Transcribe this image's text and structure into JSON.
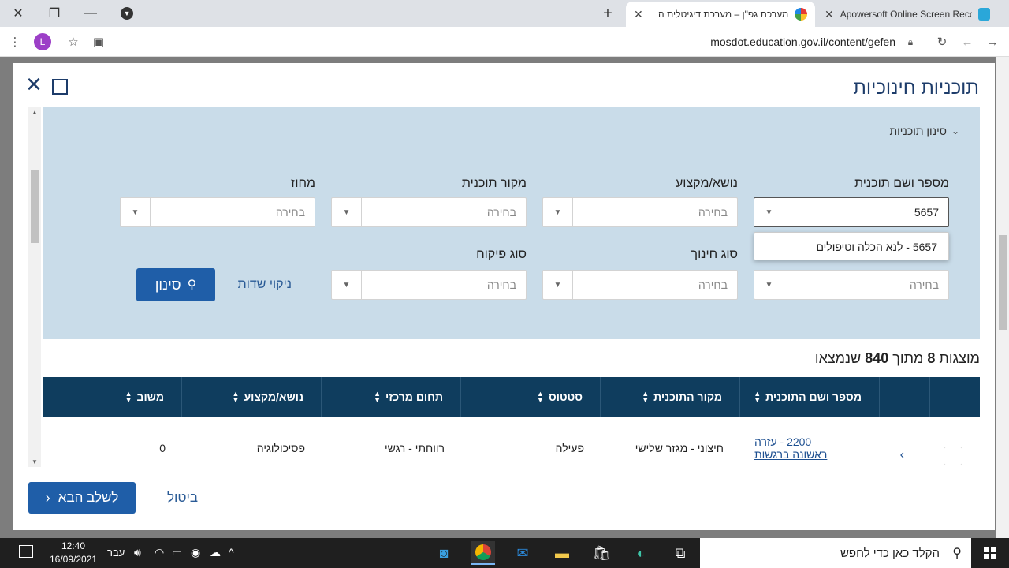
{
  "browser": {
    "tabs": [
      {
        "title": "Apowersoft Online Screen Recor",
        "active": false
      },
      {
        "title": "מערכת גפ\"ן – מערכת דיגיטלית ה",
        "active": true
      }
    ],
    "url": "mosdot.education.gov.il/content/gefen",
    "avatar_letter": "L"
  },
  "modal": {
    "title": "תוכניות חינוכיות",
    "filter_toggle": "סינון תוכניות",
    "fields": {
      "program_label": "מספר ושם תוכנית",
      "program_value": "5657",
      "subject_label": "נושא/מקצוע",
      "subject_value": "בחירה",
      "source_label": "מקור תוכנית",
      "source_value": "בחירה",
      "district_label": "מחוז",
      "district_value": "בחירה",
      "row2_first_value": "בחירה",
      "edu_type_label": "סוג חינוך",
      "edu_type_value": "בחירה",
      "supervision_label": "סוג פיקוח",
      "supervision_value": "בחירה"
    },
    "dropdown_option": "5657 - לנא הכלה וטיפולים",
    "clear_label": "ניקוי שדות",
    "filter_label": "סינון",
    "results": {
      "prefix": "מוצגות",
      "shown": "8",
      "middle": "מתוך",
      "total": "840",
      "suffix": "שנמצאו"
    },
    "table": {
      "headers": [
        "מספר ושם התוכנית",
        "מקור התוכנית",
        "סטטוס",
        "תחום מרכזי",
        "נושא/מקצוע",
        "משוב"
      ],
      "row": {
        "program_line1": "2200 - עזרה",
        "program_line2": "ראשונה ברגשות",
        "source": "חיצוני - מגזר שלישי",
        "status": "פעילה",
        "domain": "רווחתי - רגשי",
        "subject": "פסיכולוגיה",
        "feedback": "0"
      }
    },
    "next_label": "לשלב הבא",
    "cancel_label": "ביטול"
  },
  "taskbar": {
    "search_placeholder": "הקלד כאן כדי לחפש",
    "time": "12:40",
    "date": "16/09/2021",
    "lang": "עבר"
  }
}
